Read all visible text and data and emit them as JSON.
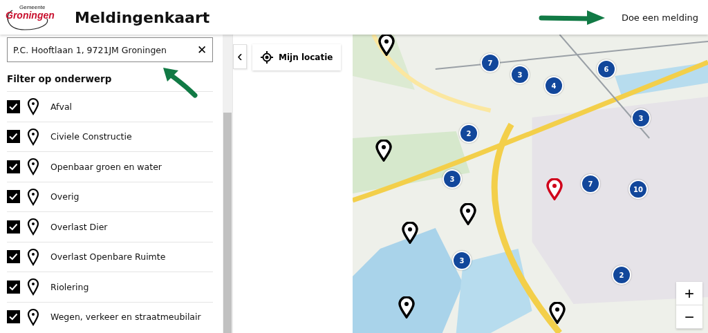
{
  "header": {
    "logo": {
      "top": "Gemeente",
      "bottom": "Groningen"
    },
    "title": "Meldingenkaart",
    "action": "Doe een melding"
  },
  "search": {
    "value": "P.C. Hooftlaan 1, 9721JM Groningen",
    "clear": "✕"
  },
  "filter": {
    "title": "Filter op onderwerp",
    "items": [
      {
        "label": "Afval",
        "checked": true
      },
      {
        "label": "Civiele Constructie",
        "checked": true
      },
      {
        "label": "Openbaar groen en water",
        "checked": true
      },
      {
        "label": "Overig",
        "checked": true
      },
      {
        "label": "Overlast Dier",
        "checked": true
      },
      {
        "label": "Overlast Openbare Ruimte",
        "checked": true
      },
      {
        "label": "Riolering",
        "checked": true
      },
      {
        "label": "Wegen, verkeer en straatmeubilair",
        "checked": true
      }
    ]
  },
  "map_controls": {
    "collapse": "‹",
    "my_location": "Mijn locatie",
    "zoom_in": "+",
    "zoom_out": "−"
  },
  "clusters": [
    {
      "count": "7"
    },
    {
      "count": "3"
    },
    {
      "count": "4"
    },
    {
      "count": "6"
    },
    {
      "count": "3"
    },
    {
      "count": "2"
    },
    {
      "count": "3"
    },
    {
      "count": "7"
    },
    {
      "count": "10"
    },
    {
      "count": "3"
    },
    {
      "count": "2"
    }
  ],
  "pins": [
    {
      "color": "#000000"
    },
    {
      "color": "#000000"
    },
    {
      "color": "#000000"
    },
    {
      "color": "#000000"
    },
    {
      "color": "#000000"
    },
    {
      "color": "#000000"
    },
    {
      "color": "#d0021b"
    }
  ]
}
